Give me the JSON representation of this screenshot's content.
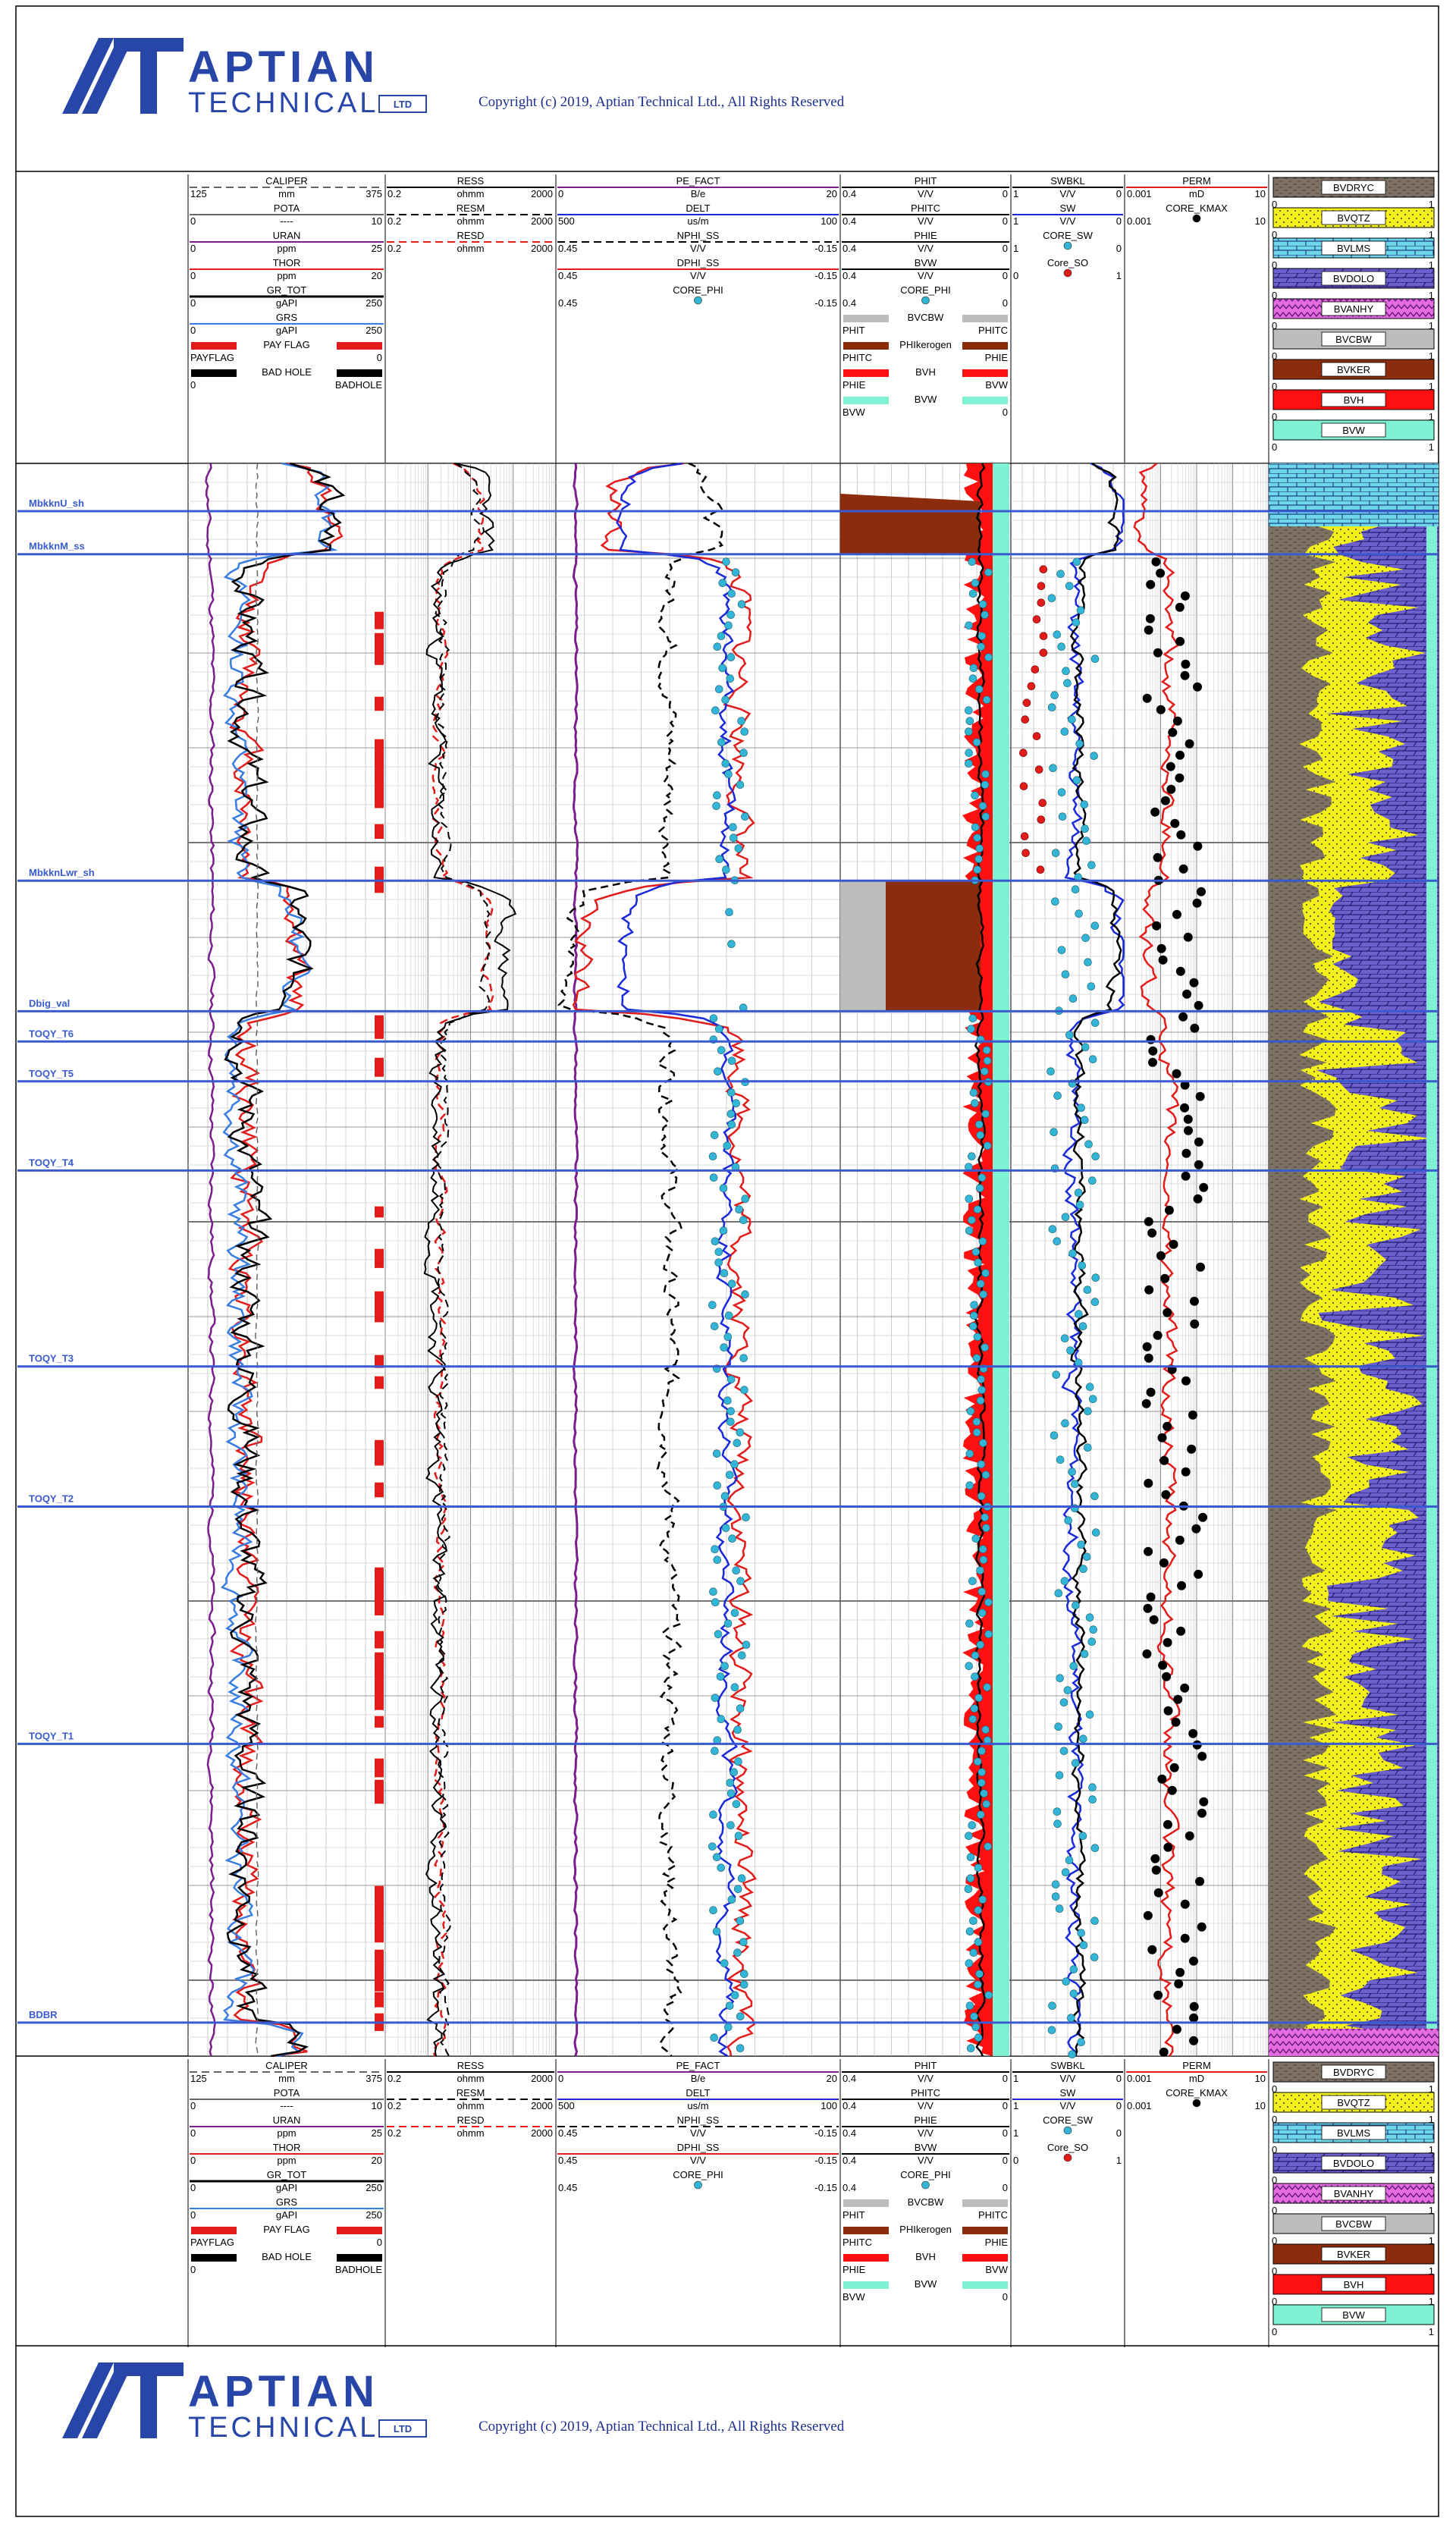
{
  "company": {
    "name_a": "APTIAN",
    "name_b": "TECHNICAL",
    "ltd": "LTD",
    "copyright": "Copyright (c) 2019, Aptian Technical Ltd., All Rights Reserved"
  },
  "colors": {
    "gr": "#000000",
    "thor": "#e21b1b",
    "uran": "#7a1e8c",
    "grs": "#3a7de0",
    "caliper": "#666666",
    "ress": "#000000",
    "resd": "#e21b1b",
    "pe": "#7a1e8c",
    "delt": "#1a2ad8",
    "nphi": "#000000",
    "dphi": "#e21b1b",
    "core": "#33b6d6",
    "bvcbw": "#bdbdbd",
    "bvker": "#8b2c0c",
    "bvh": "#ff1010",
    "bvw": "#7ef2d2",
    "bvdryc": "#7d7263",
    "bvqtz": "#f4f01c",
    "bvlms": "#6fd8e8",
    "bvdolo": "#6b60cc",
    "bvanhy": "#e36be0",
    "tops": "#3a5bd0",
    "accent": "#2746a8"
  },
  "chart_data": {
    "type": "line",
    "title": "",
    "tracks": [
      {
        "curves": [
          {
            "name": "CALIPER",
            "unit": "mm",
            "min": "125",
            "max": "375",
            "style": "dash"
          },
          {
            "name": "POTA",
            "unit": "----",
            "min": "0",
            "max": "10",
            "style": "solid"
          },
          {
            "name": "URAN",
            "unit": "ppm",
            "min": "0",
            "max": "25",
            "style": "solid"
          },
          {
            "name": "THOR",
            "unit": "ppm",
            "min": "0",
            "max": "20",
            "style": "solid"
          },
          {
            "name": "GR_TOT",
            "unit": "gAPI",
            "min": "0",
            "max": "250",
            "style": "solid"
          },
          {
            "name": "GRS",
            "unit": "gAPI",
            "min": "0",
            "max": "250",
            "style": "solid"
          }
        ],
        "fills": [
          {
            "name": "PAY FLAG",
            "left": "PAYFLAG",
            "right": "0"
          },
          {
            "name": "BAD HOLE",
            "left": "0",
            "right": "BADHOLE"
          }
        ]
      },
      {
        "curves": [
          {
            "name": "RESS",
            "unit": "ohmm",
            "min": "0.2",
            "max": "2000",
            "style": "solid"
          },
          {
            "name": "RESM",
            "unit": "ohmm",
            "min": "0.2",
            "max": "2000",
            "style": "dash"
          },
          {
            "name": "RESD",
            "unit": "ohmm",
            "min": "0.2",
            "max": "2000",
            "style": "dash"
          }
        ]
      },
      {
        "curves": [
          {
            "name": "PE_FACT",
            "unit": "B/e",
            "min": "0",
            "max": "20",
            "style": "solid"
          },
          {
            "name": "DELT",
            "unit": "us/m",
            "min": "500",
            "max": "100",
            "style": "solid"
          },
          {
            "name": "NPHI_SS",
            "unit": "V/V",
            "min": "0.45",
            "max": "-0.15",
            "style": "dash"
          },
          {
            "name": "DPHI_SS",
            "unit": "V/V",
            "min": "0.45",
            "max": "-0.15",
            "style": "solid"
          },
          {
            "name": "CORE_PHI",
            "unit": "",
            "min": "0.45",
            "max": "-0.15",
            "style": "dot"
          }
        ]
      },
      {
        "curves": [
          {
            "name": "PHIT",
            "unit": "V/V",
            "min": "0.4",
            "max": "0",
            "style": "solid"
          },
          {
            "name": "PHITC",
            "unit": "V/V",
            "min": "0.4",
            "max": "0",
            "style": "solid"
          },
          {
            "name": "PHIE",
            "unit": "V/V",
            "min": "0.4",
            "max": "0",
            "style": "solid"
          },
          {
            "name": "BVW",
            "unit": "V/V",
            "min": "0.4",
            "max": "0",
            "style": "solid"
          },
          {
            "name": "CORE_PHI",
            "unit": "",
            "min": "0.4",
            "max": "0",
            "style": "dot"
          }
        ],
        "fills": [
          {
            "name": "BVCBW",
            "left": "PHIT",
            "right": "PHITC"
          },
          {
            "name": "PHIkerogen",
            "left": "PHITC",
            "right": "PHIE"
          },
          {
            "name": "BVH",
            "left": "PHIE",
            "right": "BVW"
          },
          {
            "name": "BVW",
            "left": "BVW",
            "right": "0"
          }
        ]
      },
      {
        "curves": [
          {
            "name": "SWBKL",
            "unit": "V/V",
            "min": "1",
            "max": "0",
            "style": "solid"
          },
          {
            "name": "SW",
            "unit": "V/V",
            "min": "1",
            "max": "0",
            "style": "solid"
          },
          {
            "name": "CORE_SW",
            "unit": "",
            "min": "1",
            "max": "0",
            "style": "dot"
          },
          {
            "name": "Core_SO",
            "unit": "",
            "min": "0",
            "max": "1",
            "style": "dot"
          }
        ]
      },
      {
        "curves": [
          {
            "name": "PERM",
            "unit": "mD",
            "min": "0.001",
            "max": "10",
            "style": "solid"
          },
          {
            "name": "CORE_KMAX",
            "unit": "",
            "min": "0.001",
            "max": "10",
            "style": "dot"
          }
        ]
      },
      {
        "fills": [
          {
            "name": "BVDRYC",
            "min": "0",
            "max": "1"
          },
          {
            "name": "BVQTZ",
            "min": "0",
            "max": "1"
          },
          {
            "name": "BVLMS",
            "min": "0",
            "max": "1"
          },
          {
            "name": "BVDOLO",
            "min": "0",
            "max": "1"
          },
          {
            "name": "BVANHY",
            "min": "0",
            "max": "1"
          },
          {
            "name": "BVCBW",
            "min": "0",
            "max": "1"
          },
          {
            "name": "BVKER",
            "min": "0",
            "max": "1"
          },
          {
            "name": "BVH",
            "min": "0",
            "max": "1"
          },
          {
            "name": "BVW",
            "min": "0",
            "max": "1"
          }
        ]
      }
    ],
    "tops": [
      {
        "name": "MbkknU_sh",
        "pos": 0.03
      },
      {
        "name": "MbkknM_ss",
        "pos": 0.057
      },
      {
        "name": "MbkknLwr_sh",
        "pos": 0.262
      },
      {
        "name": "Dbig_val",
        "pos": 0.344
      },
      {
        "name": "TOQY_T6",
        "pos": 0.363
      },
      {
        "name": "TOQY_T5",
        "pos": 0.388
      },
      {
        "name": "TOQY_T4",
        "pos": 0.444
      },
      {
        "name": "TOQY_T3",
        "pos": 0.567
      },
      {
        "name": "TOQY_T2",
        "pos": 0.655
      },
      {
        "name": "TOQY_T1",
        "pos": 0.804
      },
      {
        "name": "BDBR",
        "pos": 0.979
      }
    ]
  }
}
